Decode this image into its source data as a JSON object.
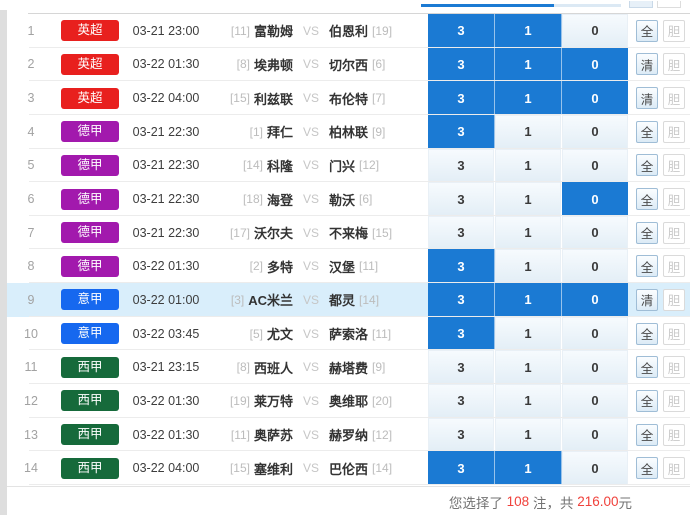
{
  "colors": {
    "selected_cell": "#1b7ad3",
    "highlight_row": "#d9eefb",
    "accent_red": "#f0413b"
  },
  "league_colors": {
    "英超": "#e8201e",
    "德甲": "#a219ad",
    "意甲": "#1668ef",
    "西甲": "#166a3b"
  },
  "option_labels": [
    "3",
    "1",
    "0"
  ],
  "rows": [
    {
      "num": "1",
      "league": "英超",
      "time": "03-21 23:00",
      "home_rank": "[11]",
      "home": "富勒姆",
      "vs": "VS",
      "away": "伯恩利",
      "away_rank": "[19]",
      "picks": [
        true,
        true,
        false
      ],
      "action": "全",
      "dan": "胆",
      "highlight": false
    },
    {
      "num": "2",
      "league": "英超",
      "time": "03-22 01:30",
      "home_rank": "[8]",
      "home": "埃弗顿",
      "vs": "VS",
      "away": "切尔西",
      "away_rank": "[6]",
      "picks": [
        true,
        true,
        true
      ],
      "action": "清",
      "dan": "胆",
      "highlight": false
    },
    {
      "num": "3",
      "league": "英超",
      "time": "03-22 04:00",
      "home_rank": "[15]",
      "home": "利兹联",
      "vs": "VS",
      "away": "布伦特",
      "away_rank": "[7]",
      "picks": [
        true,
        true,
        true
      ],
      "action": "清",
      "dan": "胆",
      "highlight": false
    },
    {
      "num": "4",
      "league": "德甲",
      "time": "03-21 22:30",
      "home_rank": "[1]",
      "home": "拜仁",
      "vs": "VS",
      "away": "柏林联",
      "away_rank": "[9]",
      "picks": [
        true,
        false,
        false
      ],
      "action": "全",
      "dan": "胆",
      "highlight": false
    },
    {
      "num": "5",
      "league": "德甲",
      "time": "03-21 22:30",
      "home_rank": "[14]",
      "home": "科隆",
      "vs": "VS",
      "away": "门兴",
      "away_rank": "[12]",
      "picks": [
        false,
        false,
        false
      ],
      "action": "全",
      "dan": "胆",
      "highlight": false
    },
    {
      "num": "6",
      "league": "德甲",
      "time": "03-21 22:30",
      "home_rank": "[18]",
      "home": "海登",
      "vs": "VS",
      "away": "勒沃",
      "away_rank": "[6]",
      "picks": [
        false,
        false,
        true
      ],
      "action": "全",
      "dan": "胆",
      "highlight": false
    },
    {
      "num": "7",
      "league": "德甲",
      "time": "03-21 22:30",
      "home_rank": "[17]",
      "home": "沃尔夫",
      "vs": "VS",
      "away": "不来梅",
      "away_rank": "[15]",
      "picks": [
        false,
        false,
        false
      ],
      "action": "全",
      "dan": "胆",
      "highlight": false
    },
    {
      "num": "8",
      "league": "德甲",
      "time": "03-22 01:30",
      "home_rank": "[2]",
      "home": "多特",
      "vs": "VS",
      "away": "汉堡",
      "away_rank": "[11]",
      "picks": [
        true,
        false,
        false
      ],
      "action": "全",
      "dan": "胆",
      "highlight": false
    },
    {
      "num": "9",
      "league": "意甲",
      "time": "03-22 01:00",
      "home_rank": "[3]",
      "home": "AC米兰",
      "vs": "VS",
      "away": "都灵",
      "away_rank": "[14]",
      "picks": [
        true,
        true,
        true
      ],
      "action": "清",
      "dan": "胆",
      "highlight": true
    },
    {
      "num": "10",
      "league": "意甲",
      "time": "03-22 03:45",
      "home_rank": "[5]",
      "home": "尤文",
      "vs": "VS",
      "away": "萨索洛",
      "away_rank": "[11]",
      "picks": [
        true,
        false,
        false
      ],
      "action": "全",
      "dan": "胆",
      "highlight": false
    },
    {
      "num": "11",
      "league": "西甲",
      "time": "03-21 23:15",
      "home_rank": "[8]",
      "home": "西班人",
      "vs": "VS",
      "away": "赫塔费",
      "away_rank": "[9]",
      "picks": [
        false,
        false,
        false
      ],
      "action": "全",
      "dan": "胆",
      "highlight": false
    },
    {
      "num": "12",
      "league": "西甲",
      "time": "03-22 01:30",
      "home_rank": "[19]",
      "home": "莱万特",
      "vs": "VS",
      "away": "奥维耶",
      "away_rank": "[20]",
      "picks": [
        false,
        false,
        false
      ],
      "action": "全",
      "dan": "胆",
      "highlight": false
    },
    {
      "num": "13",
      "league": "西甲",
      "time": "03-22 01:30",
      "home_rank": "[11]",
      "home": "奥萨苏",
      "vs": "VS",
      "away": "赫罗纳",
      "away_rank": "[12]",
      "picks": [
        false,
        false,
        false
      ],
      "action": "全",
      "dan": "胆",
      "highlight": false
    },
    {
      "num": "14",
      "league": "西甲",
      "time": "03-22 04:00",
      "home_rank": "[15]",
      "home": "塞维利",
      "vs": "VS",
      "away": "巴伦西",
      "away_rank": "[14]",
      "picks": [
        true,
        true,
        false
      ],
      "action": "全",
      "dan": "胆",
      "highlight": false
    }
  ],
  "summary": {
    "prefix": "您选择了 ",
    "count": "108",
    "mid": " 注，共 ",
    "amount": "216.00",
    "suffix": "元"
  }
}
